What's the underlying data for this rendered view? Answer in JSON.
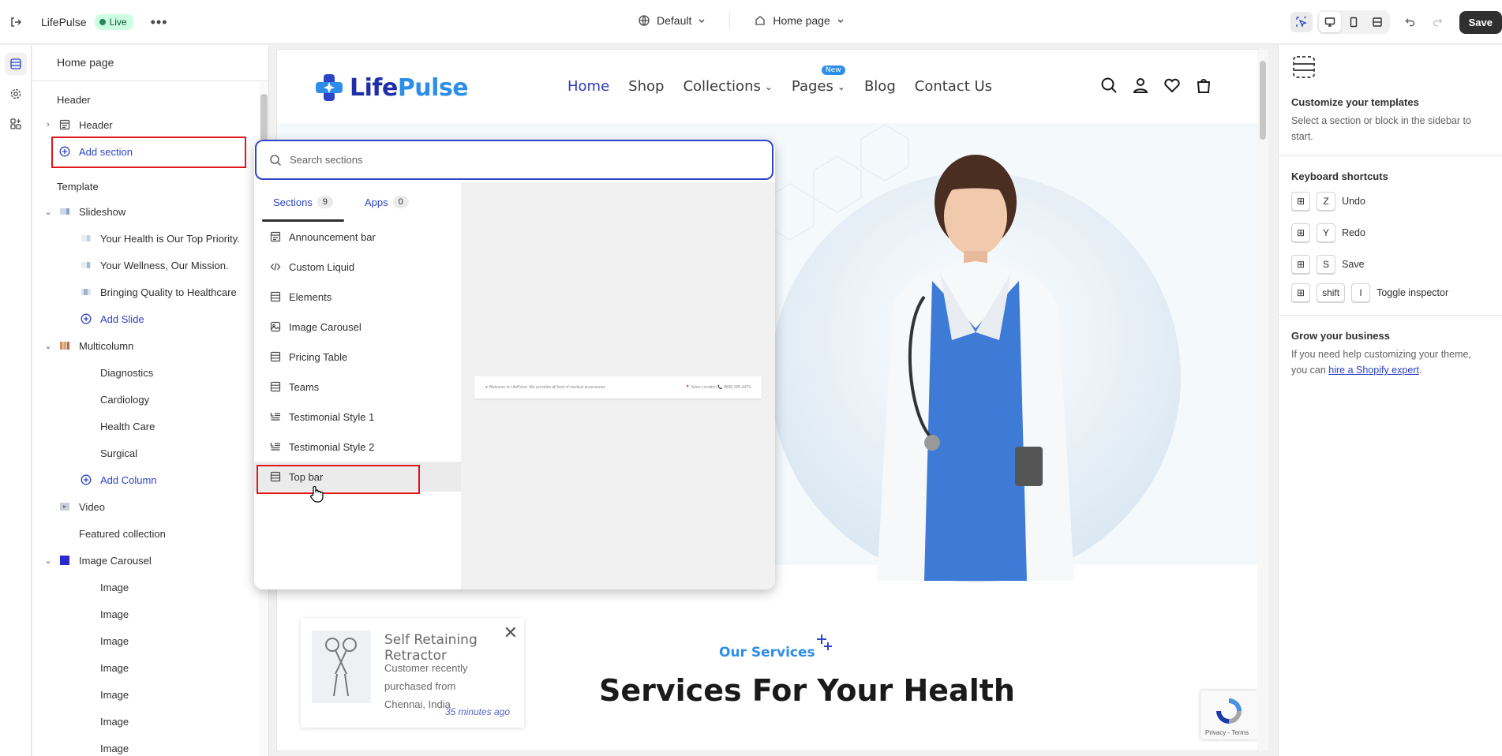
{
  "topbar": {
    "store_name": "LifePulse",
    "live_label": "Live",
    "theme_select": "Default",
    "page_select": "Home page",
    "save_label": "Save"
  },
  "sidebar": {
    "title": "Home page",
    "header_group": "Header",
    "header_item": "Header",
    "add_section": "Add section",
    "template_group": "Template",
    "slideshow": "Slideshow",
    "slides": [
      "Your Health is Our Top Priority.",
      "Your Wellness, Our Mission.",
      "Bringing Quality to Healthcare"
    ],
    "add_slide": "Add Slide",
    "multicolumn": "Multicolumn",
    "columns": [
      "Diagnostics",
      "Cardiology",
      "Health Care",
      "Surgical"
    ],
    "add_column": "Add Column",
    "video": "Video",
    "featured_collection": "Featured collection",
    "image_carousel": "Image Carousel",
    "images": [
      "Image",
      "Image",
      "Image",
      "Image",
      "Image",
      "Image",
      "Image"
    ]
  },
  "popover": {
    "search_placeholder": "Search sections",
    "tabs": [
      {
        "label": "Sections",
        "count": "9"
      },
      {
        "label": "Apps",
        "count": "0"
      }
    ],
    "items": [
      {
        "label": "Announcement bar",
        "icon": "announcement-icon"
      },
      {
        "label": "Custom Liquid",
        "icon": "code-icon"
      },
      {
        "label": "Elements",
        "icon": "layout-icon"
      },
      {
        "label": "Image Carousel",
        "icon": "image-icon"
      },
      {
        "label": "Pricing Table",
        "icon": "layout-icon"
      },
      {
        "label": "Teams",
        "icon": "layout-icon"
      },
      {
        "label": "Testimonial Style 1",
        "icon": "list-icon"
      },
      {
        "label": "Testimonial Style 2",
        "icon": "list-icon"
      },
      {
        "label": "Top bar",
        "icon": "layout-icon"
      }
    ],
    "preview_left": "♥ Welcome to LifePulse. We provides all kind of medical accessories",
    "preview_right": "📍 Store Location   📞 (808) 205-4479"
  },
  "site": {
    "logo_a": "Life",
    "logo_b": "Pulse",
    "nav": [
      "Home",
      "Shop",
      "Collections",
      "Pages",
      "Blog",
      "Contact Us"
    ],
    "new_badge": "New",
    "services_sub": "Our Services",
    "services_title": "Services For Your Health",
    "purchase": {
      "title": "Self Retaining Retractor",
      "text": "Customer recently purchased from Chennai, India",
      "time": "35 minutes ago"
    },
    "recaptcha": "Privacy - Terms"
  },
  "right_panel": {
    "customize_title": "Customize your templates",
    "customize_text": "Select a section or block in the sidebar to start.",
    "shortcuts_title": "Keyboard shortcuts",
    "shortcuts": [
      {
        "key": "Z",
        "label": "Undo"
      },
      {
        "key": "Y",
        "label": "Redo"
      },
      {
        "key": "S",
        "label": "Save"
      },
      {
        "key": "shift",
        "key2": "I",
        "label": "Toggle inspector"
      }
    ],
    "grow_title": "Grow your business",
    "grow_text": "If you need help customizing your theme, you can ",
    "grow_link": "hire a Shopify expert",
    "grow_end": "."
  },
  "colors": {
    "accent": "#2c44c8",
    "highlight": "#e1161d",
    "live_green": "#29845a"
  }
}
